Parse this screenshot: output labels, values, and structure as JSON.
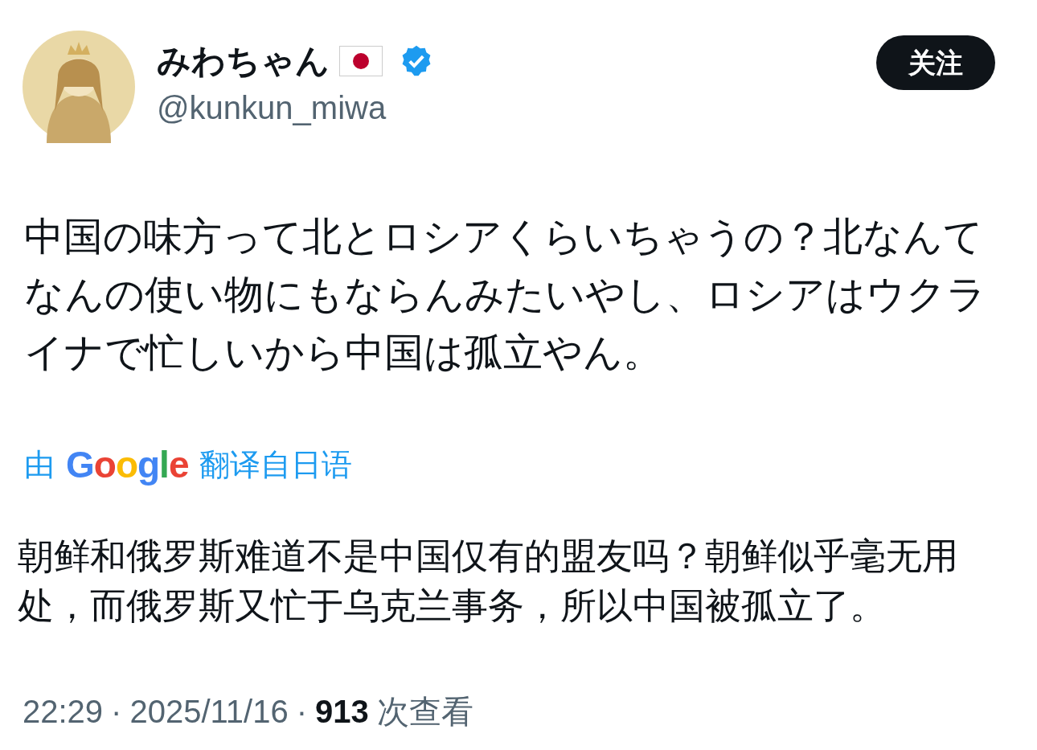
{
  "author": {
    "name": "みわちゃん",
    "verified": true,
    "handle": "@kunkun_miwa"
  },
  "follow_button": "关注",
  "tweet_text": "中国の味方って北とロシアくらいちゃうの？北なんてなんの使い物にもならんみたいやし、ロシアはウクライナで忙しいから中国は孤立やん。",
  "translation": {
    "prefix": "由",
    "provider": "Google",
    "suffix": "翻译自日语",
    "text": "朝鲜和俄罗斯难道不是中国仅有的盟友吗？朝鲜似乎毫无用处，而俄罗斯又忙于乌克兰事务，所以中国被孤立了。"
  },
  "meta": {
    "time": "22:29",
    "separator_1": "·",
    "date": "2025/11/16",
    "separator_2": "·",
    "views": "913",
    "views_label": "次查看"
  }
}
